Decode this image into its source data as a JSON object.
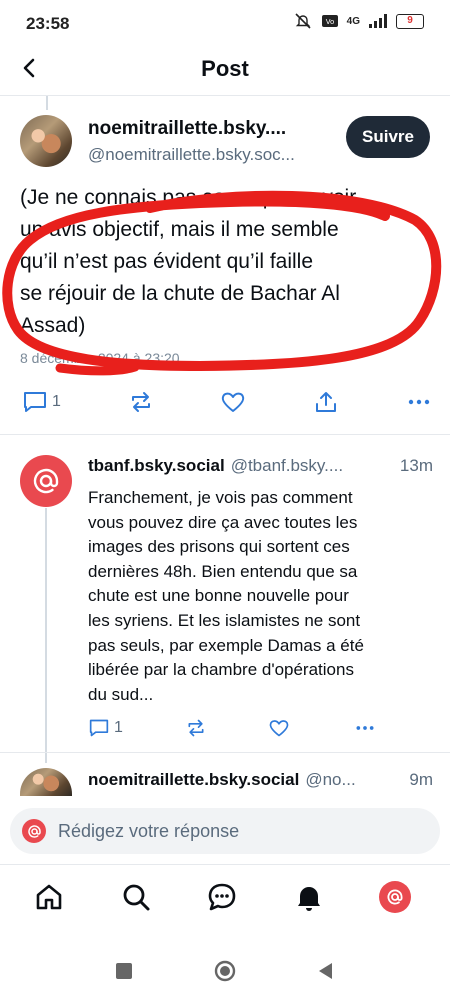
{
  "status_bar": {
    "time": "23:58",
    "network": "4G",
    "battery": "9"
  },
  "header": {
    "title": "Post"
  },
  "main_post": {
    "author_name": "noemitraillette.bsky....",
    "author_handle": "@noemitraillette.bsky.soc...",
    "follow_label": "Suivre",
    "text_lines": [
      "(Je ne connais pas assez pour avoir",
      "un avis objectif, mais il me semble",
      "qu’il n’est pas évident qu’il faille",
      "se réjouir de la chute de Bachar Al",
      "Assad)"
    ],
    "date": "8 décembre 2024 à 23:20",
    "reply_count": "1"
  },
  "reply": {
    "author_name": "tbanf.bsky.social",
    "author_handle": "@tbanf.bsky....",
    "time_ago": "13m",
    "text_lines": [
      "Franchement, je vois pas comment",
      "vous pouvez dire ça avec toutes les",
      "images des prisons qui sortent ces",
      "dernières 48h. Bien entendu que sa",
      "chute est une bonne nouvelle pour",
      "les syriens. Et les islamistes ne sont",
      "pas seuls, par exemple Damas a été",
      "libérée par la chambre d'opérations",
      "du sud..."
    ],
    "reply_count": "1"
  },
  "next_reply": {
    "author_name": "noemitraillette.bsky.social",
    "author_handle": "@no...",
    "time_ago": "9m"
  },
  "composer": {
    "placeholder": "Rédigez votre réponse"
  },
  "colors": {
    "accent": "#e9494f",
    "follow_bg": "#1f2a37",
    "annotation": "#e8201c"
  }
}
